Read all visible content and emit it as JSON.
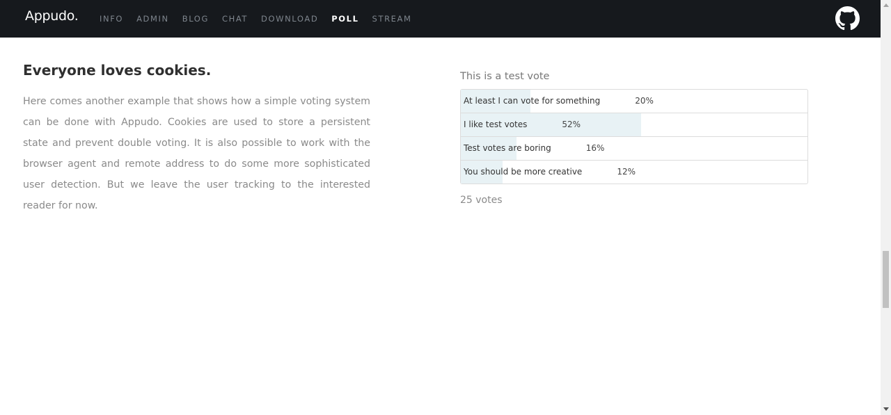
{
  "navbar": {
    "brand": "Appudo.",
    "items": [
      {
        "label": "INFO",
        "active": false
      },
      {
        "label": "ADMIN",
        "active": false
      },
      {
        "label": "BLOG",
        "active": false
      },
      {
        "label": "CHAT",
        "active": false
      },
      {
        "label": "DOWNLOAD",
        "active": false
      },
      {
        "label": "POLL",
        "active": true
      },
      {
        "label": "STREAM",
        "active": false
      }
    ],
    "github_icon": "github-icon",
    "background": "#16191d",
    "active_color": "#ffffff",
    "inactive_color": "#7e858d"
  },
  "main": {
    "heading": "Everyone loves cookies.",
    "description": "Here comes another example that shows how a simple voting system can be done with Appudo. Cookies are used to store a persistent state and prevent double voting. It is also possible to work with the browser agent and remote address to do some more sophisticated user detection. But we leave the user tracking to the interested reader for now."
  },
  "poll": {
    "title": "This is a test vote",
    "bar_color": "#e8f2f5",
    "options": [
      {
        "label": "At least I can vote for something",
        "percent_label": "20%",
        "percent": 20
      },
      {
        "label": "I like test votes",
        "percent_label": "52%",
        "percent": 52
      },
      {
        "label": "Test votes are boring",
        "percent_label": "16%",
        "percent": 16
      },
      {
        "label": "You should be more creative",
        "percent_label": "12%",
        "percent": 12
      }
    ],
    "votes": "25 votes"
  }
}
